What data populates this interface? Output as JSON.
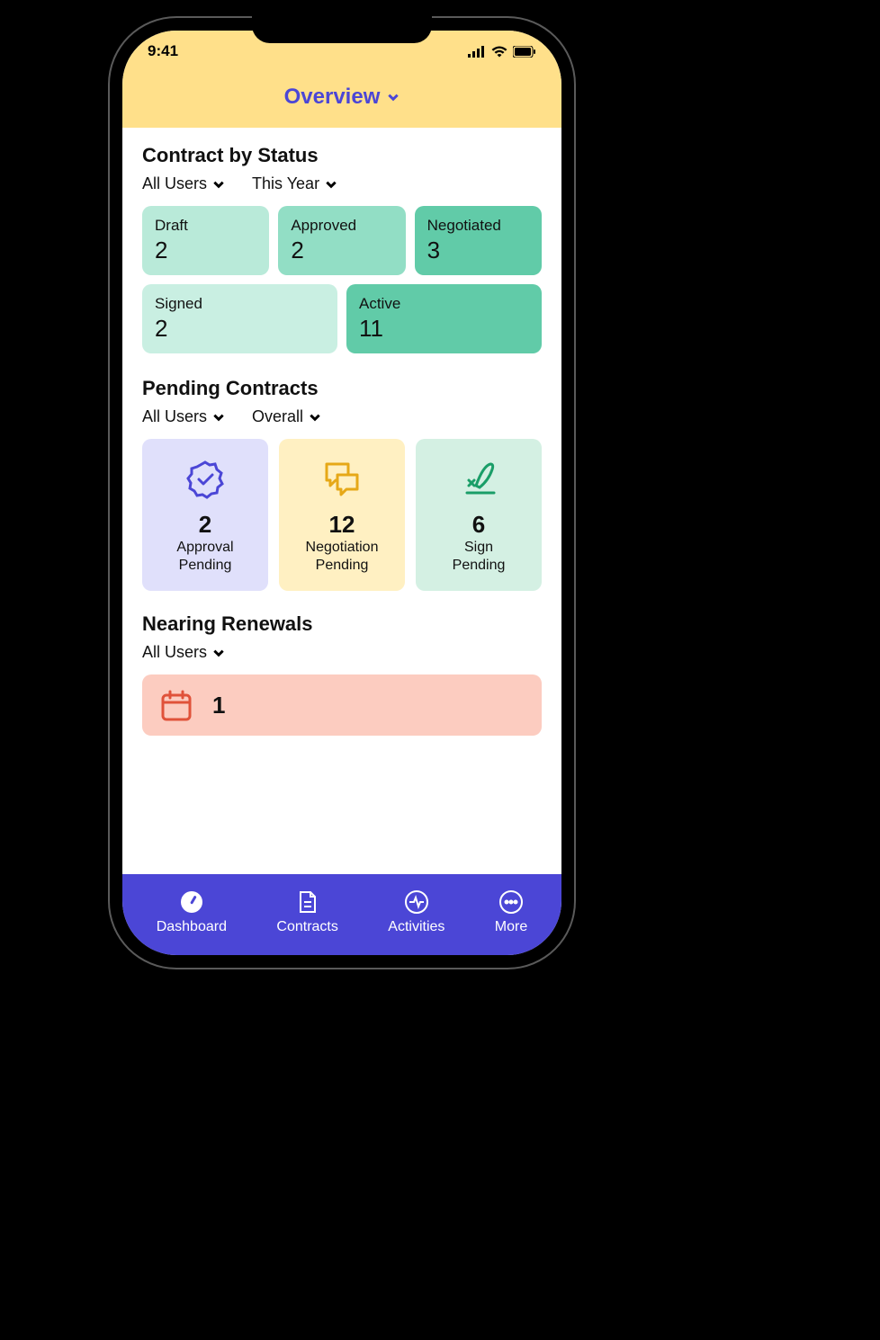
{
  "status_bar": {
    "time": "9:41"
  },
  "header": {
    "title": "Overview"
  },
  "contract_status": {
    "title": "Contract by Status",
    "filters": {
      "users": "All Users",
      "period": "This Year"
    },
    "cards": [
      {
        "label": "Draft",
        "value": "2",
        "color": "#b9ead9"
      },
      {
        "label": "Approved",
        "value": "2",
        "color": "#92dec5"
      },
      {
        "label": "Negotiated",
        "value": "3",
        "color": "#61cba8"
      },
      {
        "label": "Signed",
        "value": "2",
        "color": "#c9efe2"
      },
      {
        "label": "Active",
        "value": "11",
        "color": "#61cba8"
      }
    ]
  },
  "pending": {
    "title": "Pending Contracts",
    "filters": {
      "users": "All Users",
      "period": "Overall"
    },
    "cards": [
      {
        "value": "2",
        "label1": "Approval",
        "label2": "Pending",
        "bg": "#e0e0fb",
        "icon": "badge"
      },
      {
        "value": "12",
        "label1": "Negotiation",
        "label2": "Pending",
        "bg": "#fff0c2",
        "icon": "chat"
      },
      {
        "value": "6",
        "label1": "Sign",
        "label2": "Pending",
        "bg": "#d4f0e3",
        "icon": "sign"
      }
    ]
  },
  "renewals": {
    "title": "Nearing Renewals",
    "filter": "All Users",
    "value": "1"
  },
  "tabs": [
    {
      "label": "Dashboard",
      "icon": "dashboard"
    },
    {
      "label": "Contracts",
      "icon": "document"
    },
    {
      "label": "Activities",
      "icon": "activity"
    },
    {
      "label": "More",
      "icon": "more"
    }
  ]
}
